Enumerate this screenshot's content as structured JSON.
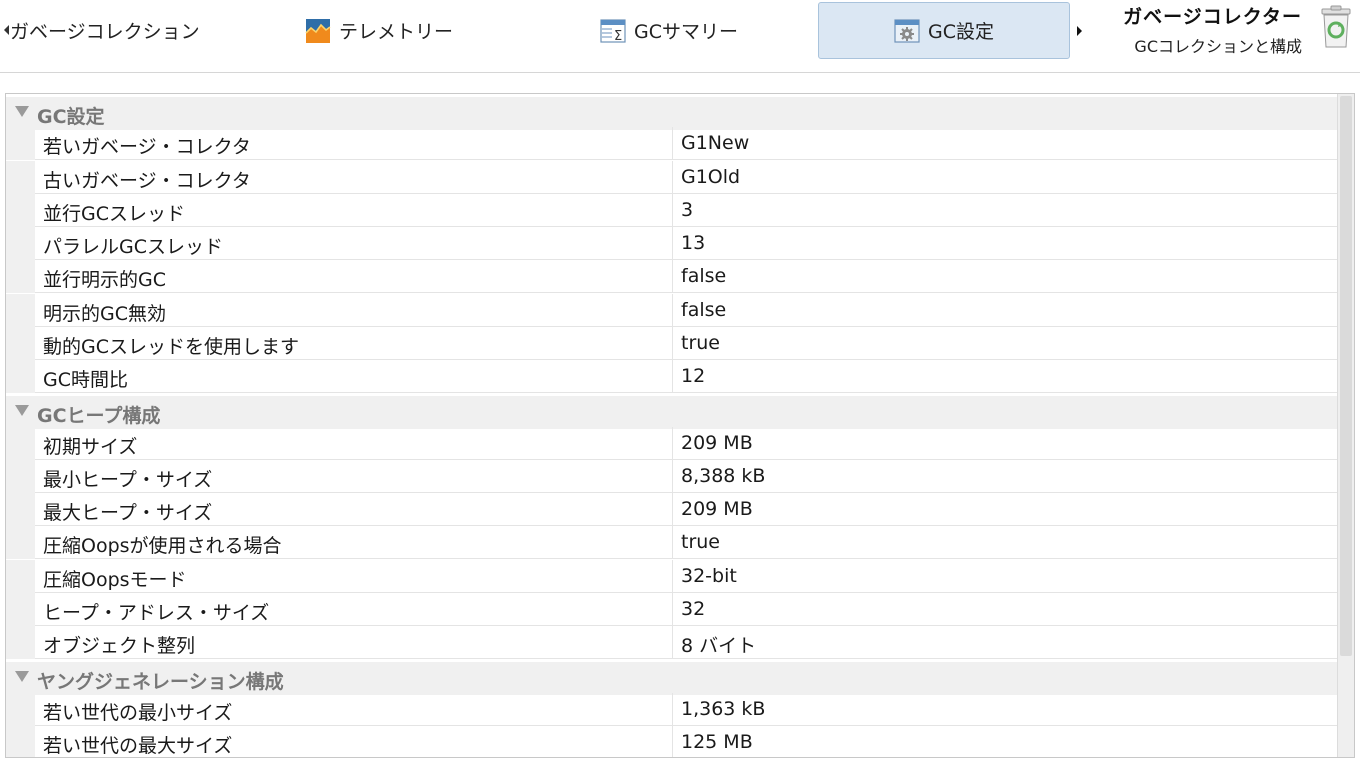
{
  "tabs": [
    {
      "label": "ガベージコレクション",
      "icon": "none"
    },
    {
      "label": "テレメトリー",
      "icon": "telemetry-icon"
    },
    {
      "label": "GCサマリー",
      "icon": "gc-summary-icon"
    },
    {
      "label": "GC設定",
      "icon": "gc-settings-icon",
      "active": true
    }
  ],
  "heading": {
    "title": "ガベージコレクター",
    "subtitle": "GCコレクションと構成",
    "icon": "recycle-bin-icon"
  },
  "groups": [
    {
      "title": "GC設定",
      "rows": [
        {
          "name": "若いガベージ・コレクタ",
          "value": "G1New"
        },
        {
          "name": "古いガベージ・コレクタ",
          "value": "G1Old"
        },
        {
          "name": "並行GCスレッド",
          "value": "3"
        },
        {
          "name": "パラレルGCスレッド",
          "value": "13"
        },
        {
          "name": "並行明示的GC",
          "value": "false"
        },
        {
          "name": "明示的GC無効",
          "value": "false"
        },
        {
          "name": "動的GCスレッドを使用します",
          "value": "true"
        },
        {
          "name": "GC時間比",
          "value": "12"
        }
      ]
    },
    {
      "title": "GCヒープ構成",
      "rows": [
        {
          "name": "初期サイズ",
          "value": "209 MB"
        },
        {
          "name": "最小ヒープ・サイズ",
          "value": "8,388 kB"
        },
        {
          "name": "最大ヒープ・サイズ",
          "value": "209 MB"
        },
        {
          "name": "圧縮Oopsが使用される場合",
          "value": "true"
        },
        {
          "name": "圧縮Oopsモード",
          "value": "32-bit"
        },
        {
          "name": "ヒープ・アドレス・サイズ",
          "value": "32"
        },
        {
          "name": "オブジェクト整列",
          "value": "8 バイト"
        }
      ]
    },
    {
      "title": "ヤングジェネレーション構成",
      "rows": [
        {
          "name": "若い世代の最小サイズ",
          "value": "1,363 kB"
        },
        {
          "name": "若い世代の最大サイズ",
          "value": "125 MB"
        }
      ]
    }
  ],
  "colors": {
    "active_tab_bg": "#dbe7f3",
    "active_tab_border": "#a9c3dc",
    "group_header_bg": "#f0f0f0",
    "group_title": "#777777"
  }
}
